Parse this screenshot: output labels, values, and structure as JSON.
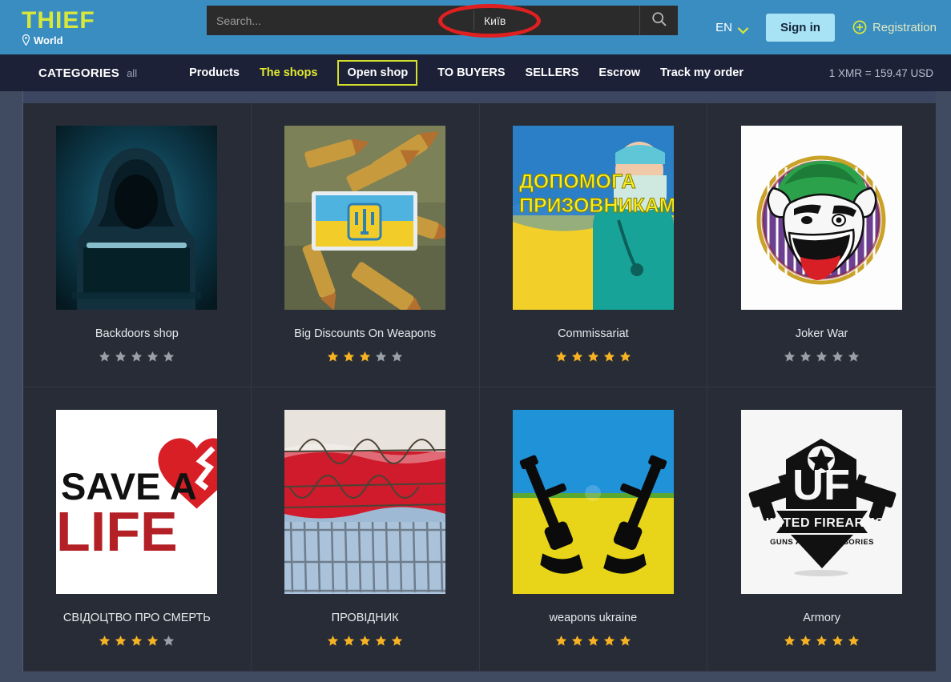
{
  "colors": {
    "header_bg": "#3a8dc0",
    "nav_bg": "#1c2138",
    "logo_accent": "#d8e83a",
    "nav_accent": "#e2ea2e",
    "signin_bg": "#a8e2f5",
    "panel_bg": "#282c36",
    "page_bg": "#404a61",
    "star_filled": "#f5b324",
    "star_empty": "#9aa0a8",
    "highlight_ellipse": "#e02020"
  },
  "header": {
    "logo": {
      "main": "THIEF",
      "sub": "World",
      "pin_icon": "location-pin-icon"
    },
    "search": {
      "placeholder": "Search...",
      "value": "",
      "city_value": "Київ",
      "search_icon": "search-icon"
    },
    "language": {
      "label": "EN",
      "chevron_icon": "chevron-down-icon"
    },
    "sign_in_label": "Sign in",
    "registration": {
      "label": "Registration",
      "icon": "plus-circle-icon"
    }
  },
  "nav": {
    "categories_label": "CATEGORIES",
    "categories_all": "all",
    "items": [
      {
        "label": "Products",
        "style": "plain"
      },
      {
        "label": "The shops",
        "style": "accent"
      },
      {
        "label": "Open shop",
        "style": "boxed"
      },
      {
        "label": "TO BUYERS",
        "style": "plain"
      },
      {
        "label": "SELLERS",
        "style": "plain"
      },
      {
        "label": "Escrow",
        "style": "plain"
      },
      {
        "label": "Track my order",
        "style": "plain"
      }
    ],
    "exchange_rate": "1 XMR = 159.47 USD"
  },
  "shops": [
    {
      "title": "Backdoors shop",
      "rating": 0,
      "max_rating": 5,
      "thumb": "hacker-hoodie-laptop-image"
    },
    {
      "title": "Big Discounts On Weapons",
      "rating": 3,
      "max_rating": 5,
      "thumb": "bullets-ukraine-flag-patch-image"
    },
    {
      "title": "Commissariat",
      "rating": 5,
      "max_rating": 5,
      "thumb": "medic-ukraine-flag-image",
      "thumb_text_line1": "ДОПОМОГА",
      "thumb_text_line2": "ПРИЗОВНИКАМ"
    },
    {
      "title": "Joker War",
      "rating": 0,
      "max_rating": 5,
      "thumb": "joker-face-logo-image"
    },
    {
      "title": "СВІДОЦТВО ПРО СМЕРТЬ",
      "rating": 4,
      "max_rating": 5,
      "thumb": "save-a-life-broken-heart-image",
      "thumb_text_line1": "SAVE A",
      "thumb_text_line2": "LIFE"
    },
    {
      "title": "ПРОВІДНИК",
      "rating": 5,
      "max_rating": 5,
      "thumb": "poland-flag-barbed-wire-fence-image"
    },
    {
      "title": "weapons ukraine",
      "rating": 5,
      "max_rating": 5,
      "thumb": "ukraine-flag-crossed-rifles-image"
    },
    {
      "title": "Armory",
      "rating": 5,
      "max_rating": 5,
      "thumb": "united-firearms-logo-image",
      "thumb_text_line1": "UF",
      "thumb_text_line2": "UNITED FIREARMS",
      "thumb_text_line3": "GUNS AND ACCESSORIES"
    }
  ]
}
